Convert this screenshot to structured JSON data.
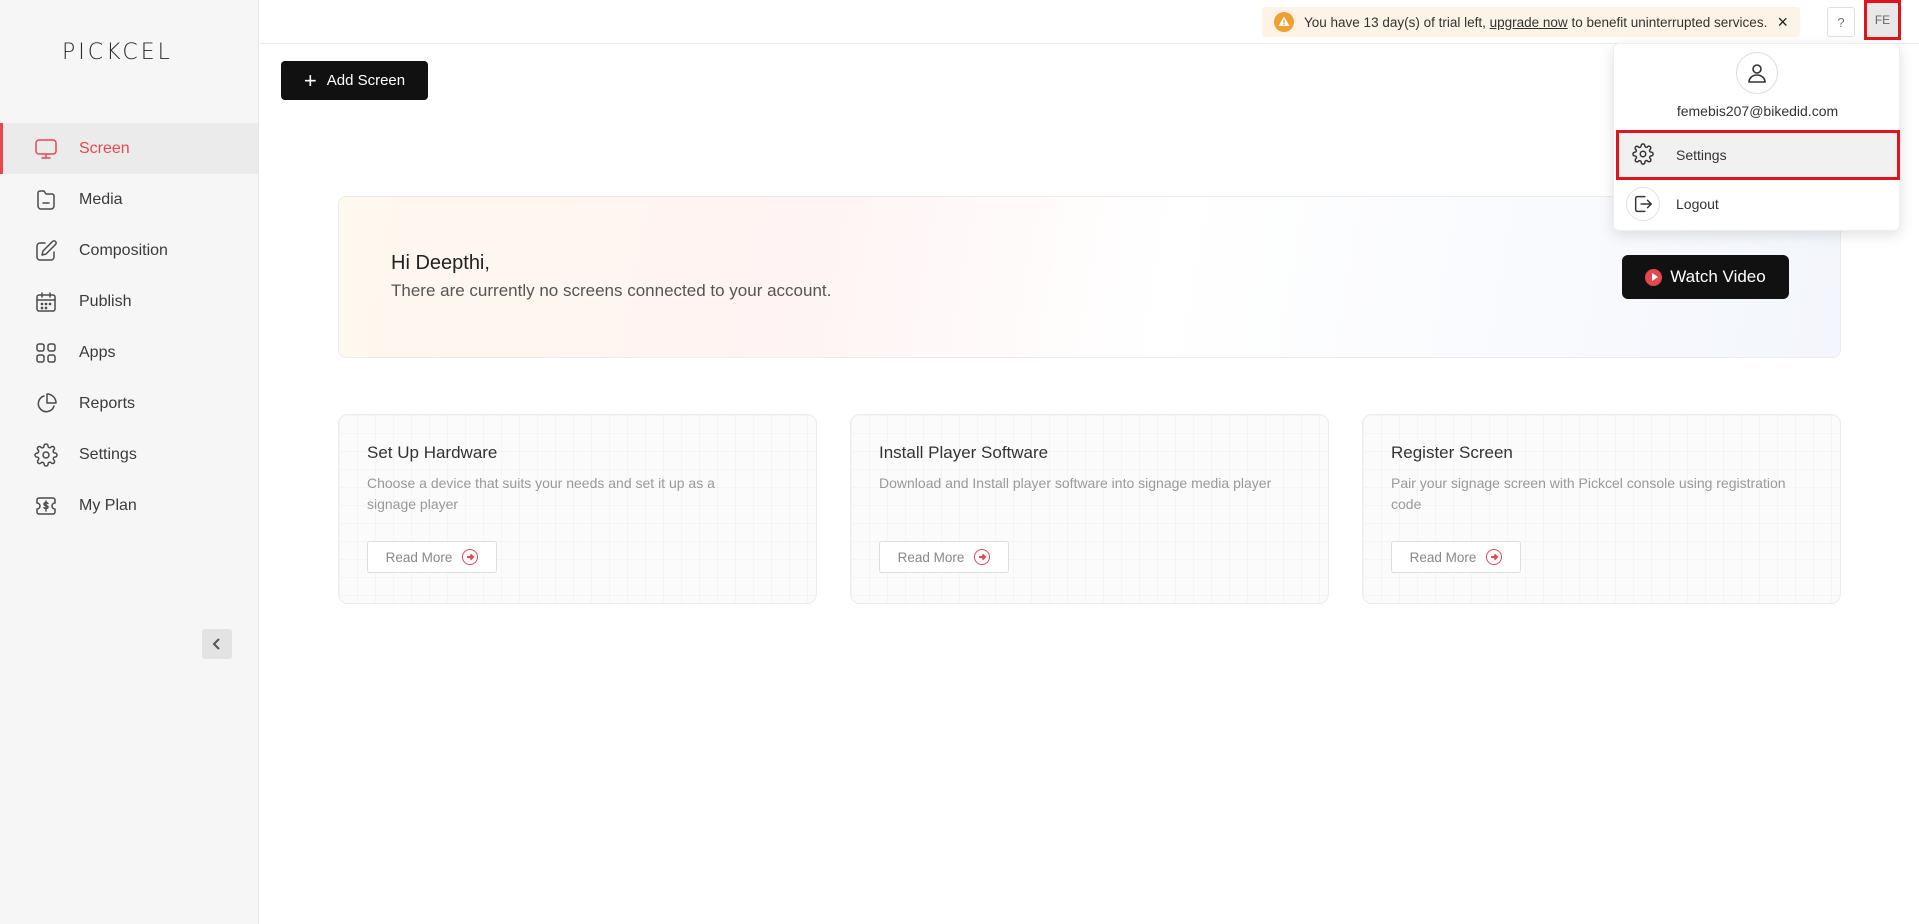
{
  "app": {
    "logo": "PICKCEL"
  },
  "sidebar": {
    "items": [
      {
        "label": "Screen",
        "icon": "monitor-icon",
        "active": true
      },
      {
        "label": "Media",
        "icon": "folder-icon"
      },
      {
        "label": "Composition",
        "icon": "edit-icon"
      },
      {
        "label": "Publish",
        "icon": "calendar-icon"
      },
      {
        "label": "Apps",
        "icon": "grid-icon"
      },
      {
        "label": "Reports",
        "icon": "pie-chart-icon"
      },
      {
        "label": "Settings",
        "icon": "gear-icon"
      },
      {
        "label": "My Plan",
        "icon": "dollar-ticket-icon"
      }
    ]
  },
  "topbar": {
    "trial_prefix": "You have 13 day(s) of trial left,",
    "trial_link": "upgrade now",
    "trial_suffix": "to benefit uninterrupted services.",
    "close": "×",
    "help": "?",
    "avatar_initials": "FE"
  },
  "toolbar": {
    "add_screen_label": "Add Screen"
  },
  "hero": {
    "greeting": "Hi Deepthi,",
    "message": "There are currently no screens connected to your account.",
    "watch_label": "Watch Video"
  },
  "cards": [
    {
      "title": "Set Up Hardware",
      "desc": "Choose a device that suits your needs and set it up as a signage player",
      "button": "Read More"
    },
    {
      "title": "Install Player Software",
      "desc": "Download and Install player software into signage media player",
      "button": "Read More"
    },
    {
      "title": "Register Screen",
      "desc": "Pair your signage screen with Pickcel console using registration code",
      "button": "Read More"
    }
  ],
  "user_menu": {
    "email": "femebis207@bikedid.com",
    "settings_label": "Settings",
    "logout_label": "Logout"
  },
  "colors": {
    "accent": "#e5484d",
    "highlight": "#e0141c",
    "primary_button": "#111111"
  }
}
